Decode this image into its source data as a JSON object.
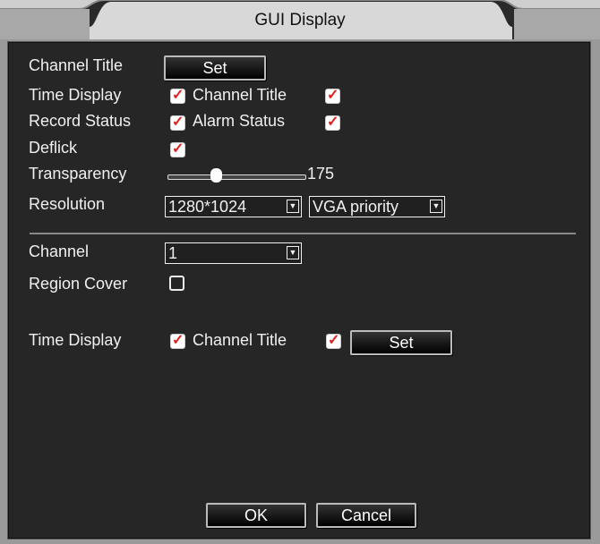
{
  "window": {
    "title": "GUI Display"
  },
  "osd": {
    "channel_title_label": "Channel Title",
    "channel_title_button": "Set",
    "time_display_label": "Time Display",
    "time_display_checked": true,
    "channel_title_check_label": "Channel Title",
    "channel_title_checked": true,
    "record_status_label": "Record Status",
    "record_status_checked": true,
    "alarm_status_label": "Alarm Status",
    "alarm_status_checked": true,
    "deflick_label": "Deflick",
    "deflick_checked": true,
    "transparency_label": "Transparency",
    "transparency_value": "175",
    "transparency_level": 0.34,
    "resolution_label": "Resolution",
    "resolution_value": "1280*1024",
    "output_mode_value": "VGA priority"
  },
  "channel_section": {
    "channel_label": "Channel",
    "channel_value": "1",
    "region_cover_label": "Region Cover",
    "region_cover_checked": false,
    "time_display_label": "Time Display",
    "time_display_checked": true,
    "channel_title_label": "Channel Title",
    "channel_title_checked": true,
    "set_button": "Set"
  },
  "footer": {
    "ok_label": "OK",
    "cancel_label": "Cancel"
  },
  "colors": {
    "panel_bg": "#262626",
    "frame": "#9a9a9a",
    "check_mark": "#e02020"
  }
}
